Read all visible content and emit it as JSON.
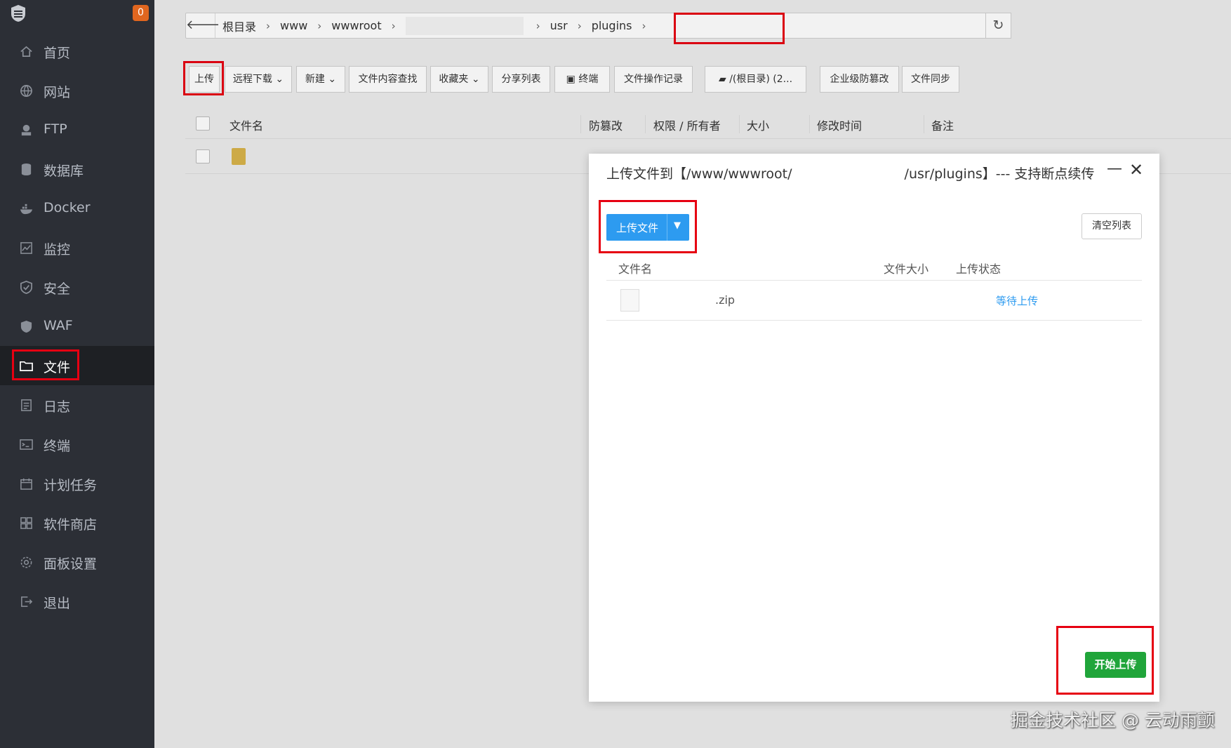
{
  "sidebar": {
    "badge": "0",
    "items": [
      {
        "label": "首页",
        "icon": "home-icon"
      },
      {
        "label": "网站",
        "icon": "globe-icon"
      },
      {
        "label": "FTP",
        "icon": "ftp-icon"
      },
      {
        "label": "数据库",
        "icon": "database-icon"
      },
      {
        "label": "Docker",
        "icon": "docker-icon"
      },
      {
        "label": "监控",
        "icon": "monitor-icon"
      },
      {
        "label": "安全",
        "icon": "shield-icon"
      },
      {
        "label": "WAF",
        "icon": "waf-icon"
      },
      {
        "label": "文件",
        "icon": "folder-icon"
      },
      {
        "label": "日志",
        "icon": "log-icon"
      },
      {
        "label": "终端",
        "icon": "terminal-icon"
      },
      {
        "label": "计划任务",
        "icon": "calendar-icon"
      },
      {
        "label": "软件商店",
        "icon": "apps-icon"
      },
      {
        "label": "面板设置",
        "icon": "settings-icon"
      },
      {
        "label": "退出",
        "icon": "logout-icon"
      }
    ],
    "active_index": 8
  },
  "pathbar": {
    "crumbs": [
      "根目录",
      "www",
      "wwwroot"
    ],
    "crumbs_highlighted": [
      "usr",
      "plugins"
    ]
  },
  "toolbar": {
    "upload": "上传",
    "remote_download": "远程下载",
    "new": "新建",
    "content_search": "文件内容查找",
    "favorites": "收藏夹",
    "share_list": "分享列表",
    "terminal": "终端",
    "op_log": "文件操作记录",
    "disk": "/(根目录) (2...",
    "enterprise_tamper": "企业级防篡改",
    "file_sync": "文件同步"
  },
  "file_table": {
    "headers": {
      "name": "文件名",
      "tamper": "防篡改",
      "perm_owner": "权限 / 所有者",
      "size": "大小",
      "mtime": "修改时间",
      "remark": "备注"
    }
  },
  "dialog": {
    "title_prefix": "上传文件到【/www/wwwroot/",
    "title_suffix": "/usr/plugins】--- 支持断点续传",
    "min_symbol": "—",
    "close_symbol": "✕",
    "upload_file_button": "上传文件",
    "clear_list_button": "清空列表",
    "columns": {
      "name": "文件名",
      "size": "文件大小",
      "status": "上传状态"
    },
    "files": [
      {
        "name": ".zip",
        "size": "",
        "status": "等待上传"
      }
    ],
    "start_upload_button": "开始上传"
  },
  "watermark": "掘金技术社区 @ 云动雨颤",
  "colors": {
    "sidebar_bg": "#2c2f36",
    "highlight_red": "#e60012",
    "primary_blue": "#2d9bf0",
    "success_green": "#20a53a",
    "badge_orange": "#e0661f"
  }
}
